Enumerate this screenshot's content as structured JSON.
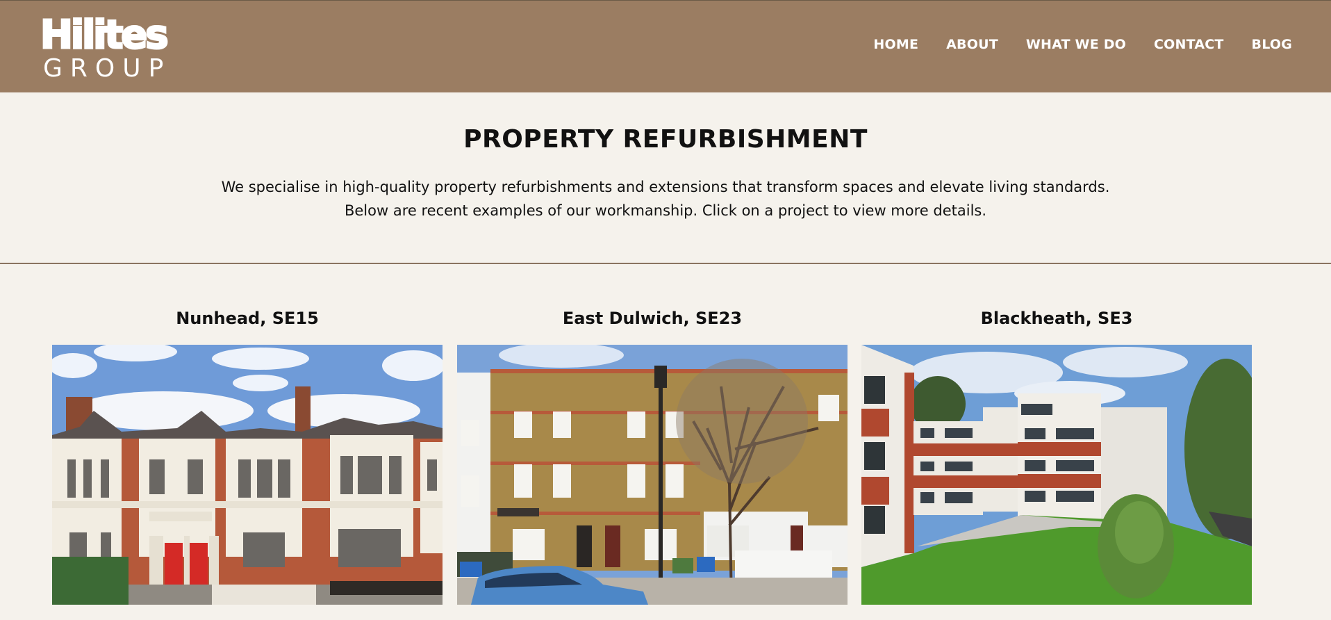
{
  "header": {
    "logo": {
      "line1": "Hilites",
      "line2": "GROUP"
    },
    "nav": [
      "HOME",
      "ABOUT",
      "WHAT WE DO",
      "CONTACT",
      "BLOG"
    ]
  },
  "page": {
    "title": "PROPERTY REFURBISHMENT",
    "intro_line1": "We specialise in high-quality property refurbishments and extensions that transform spaces and elevate living standards.",
    "intro_line2": "Below are recent examples of our workmanship. Click on a project to view more details."
  },
  "projects": [
    {
      "title": "Nunhead, SE15"
    },
    {
      "title": "East Dulwich, SE23"
    },
    {
      "title": "Blackheath, SE3"
    }
  ],
  "colors": {
    "header_bg": "#9b7d62",
    "page_bg": "#f5f2ec",
    "divider": "#8a7460",
    "text": "#111111",
    "nav_text": "#ffffff"
  }
}
